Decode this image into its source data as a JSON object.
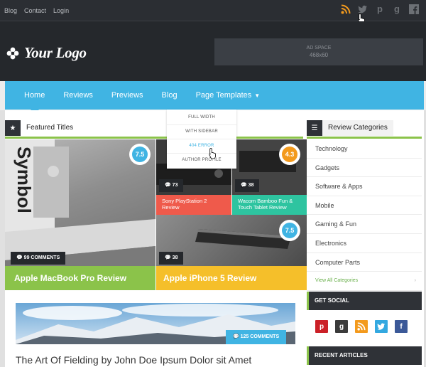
{
  "topbar": {
    "links": [
      "Blog",
      "Contact",
      "Login"
    ],
    "social_icons": [
      "rss-icon",
      "twitter-icon",
      "pinterest-icon",
      "googleplus-icon",
      "facebook-icon"
    ]
  },
  "header": {
    "logo_text": "Your Logo",
    "ad_title": "AD SPACE",
    "ad_size": "468x60"
  },
  "nav": {
    "items": [
      "Home",
      "Reviews",
      "Previews",
      "Blog",
      "Page Templates"
    ],
    "dropdown": [
      "FULL WIDTH",
      "WITH SIDEBAR",
      "404 ERROR",
      "AUTHOR PROFILE"
    ]
  },
  "featured": {
    "heading": "Featured Titles",
    "tiles": [
      {
        "comments": "99 COMMENTS",
        "rating": "7.5",
        "title": "Apple MacBook Pro Review",
        "color": "#8bc34a"
      },
      {
        "comments": "73",
        "rating": "",
        "title": "Sony PlayStation 2 Review",
        "color": "#ef5a4b"
      },
      {
        "comments": "38",
        "rating": "4.3",
        "title": "Wacom Bamboo Fun & Touch Tablet Review",
        "color": "#2ec4a0"
      },
      {
        "comments": "38",
        "rating": "7.5",
        "title": "Apple iPhone 5 Review",
        "color": "#f5bf2a"
      }
    ]
  },
  "categories": {
    "heading": "Review Categories",
    "items": [
      "Technology",
      "Gadgets",
      "Software & Apps",
      "Mobile",
      "Gaming & Fun",
      "Electronics",
      "Computer Parts"
    ],
    "view_all": "View All Categories"
  },
  "social": {
    "heading": "GET SOCIAL",
    "buttons": [
      {
        "icon": "pinterest-icon",
        "glyph": "p",
        "color": "#cb2027"
      },
      {
        "icon": "googleplus-icon",
        "glyph": "g",
        "color": "#3b3b3b"
      },
      {
        "icon": "rss-icon",
        "glyph": "r",
        "color": "#f39a1d"
      },
      {
        "icon": "twitter-icon",
        "glyph": "t",
        "color": "#33a8e0"
      },
      {
        "icon": "facebook-icon",
        "glyph": "f",
        "color": "#3b5998"
      }
    ]
  },
  "recent": {
    "heading": "RECENT ARTICLES"
  },
  "post": {
    "comments": "125 COMMENTS",
    "title": "The Art Of Fielding by John Doe Ipsum Dolor sit Amet"
  },
  "colors": {
    "accent": "#40b4e3",
    "green": "#8bc34a",
    "dark": "#25282c"
  }
}
